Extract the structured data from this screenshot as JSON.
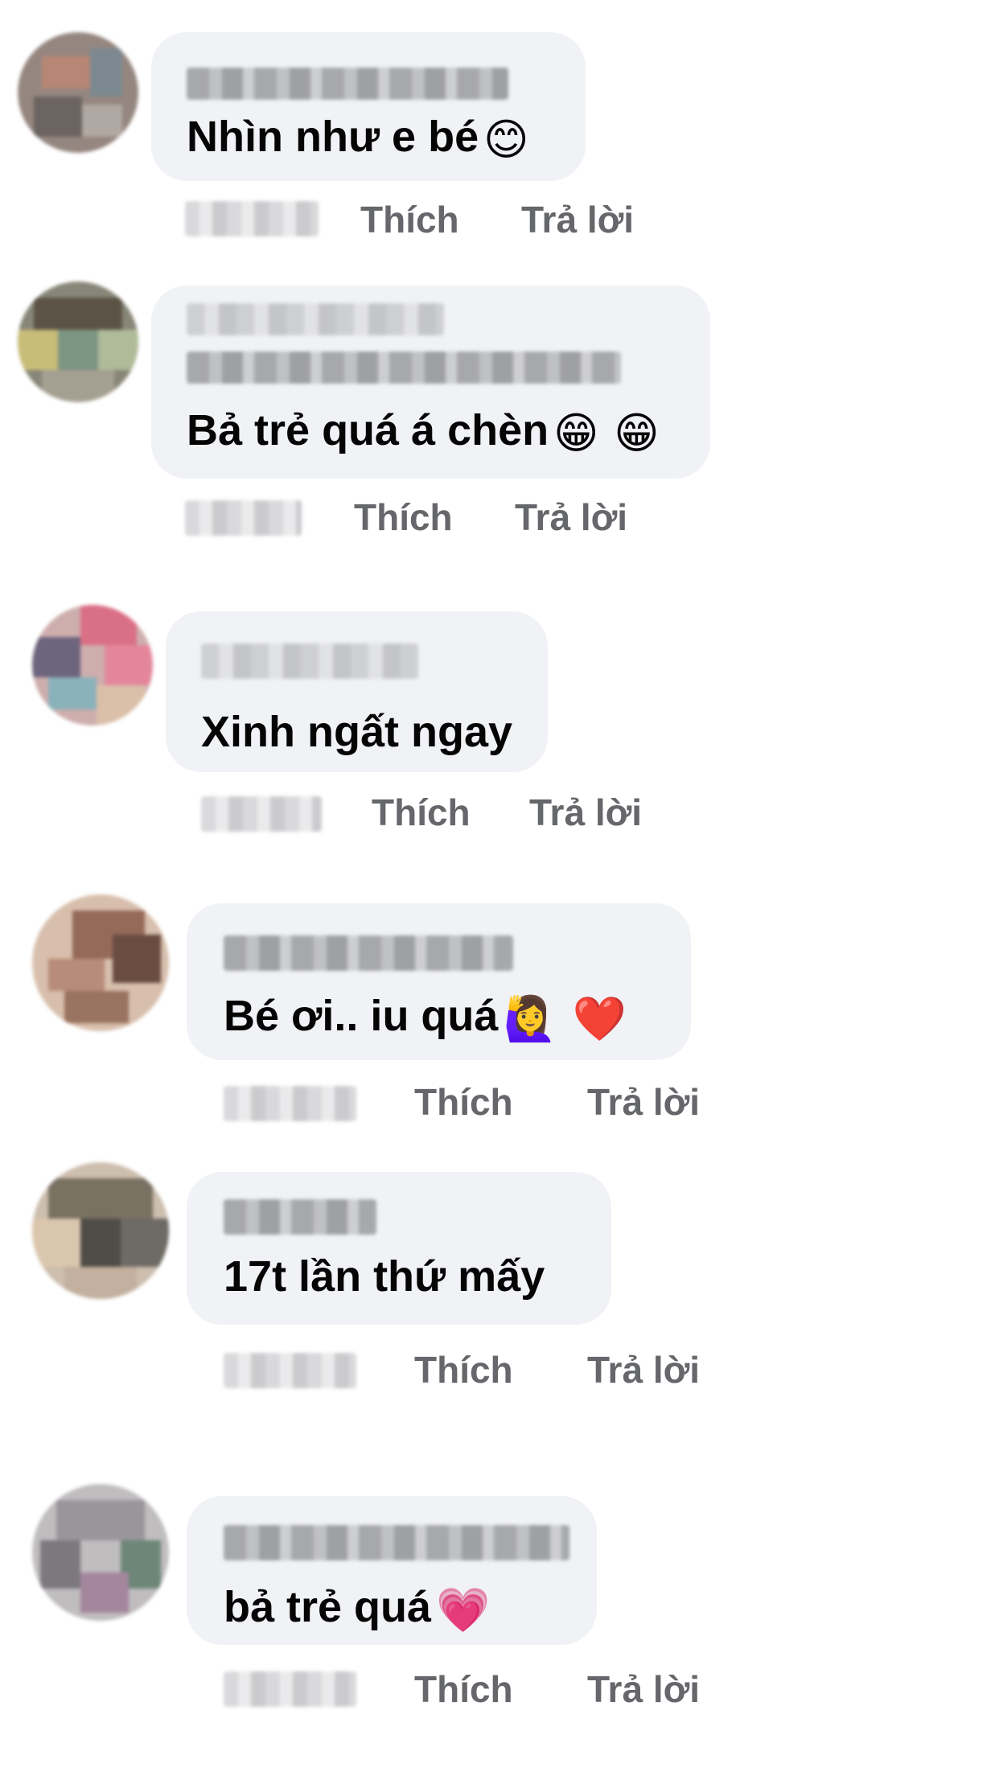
{
  "comments": [
    {
      "text": "Nhìn như e bé",
      "emoji": "😊",
      "like_label": "Thích",
      "reply_label": "Trả lời"
    },
    {
      "text": "Bả trẻ quá á chèn",
      "emoji": "😁 😁",
      "like_label": "Thích",
      "reply_label": "Trả lời"
    },
    {
      "text": "Xinh ngất ngay",
      "emoji": "",
      "like_label": "Thích",
      "reply_label": "Trả lời"
    },
    {
      "text": "Bé ơi.. iu quá",
      "emoji": "🙋‍♀️ ❤️",
      "like_label": "Thích",
      "reply_label": "Trả lời"
    },
    {
      "text": "17t lần thứ mấy",
      "emoji": "",
      "like_label": "Thích",
      "reply_label": "Trả lời"
    },
    {
      "text": "bả trẻ quá",
      "emoji": "💗",
      "like_label": "Thích",
      "reply_label": "Trả lời"
    }
  ],
  "colors": {
    "bubble": "#f0f2f5",
    "text": "#050505",
    "action": "#65676b"
  }
}
